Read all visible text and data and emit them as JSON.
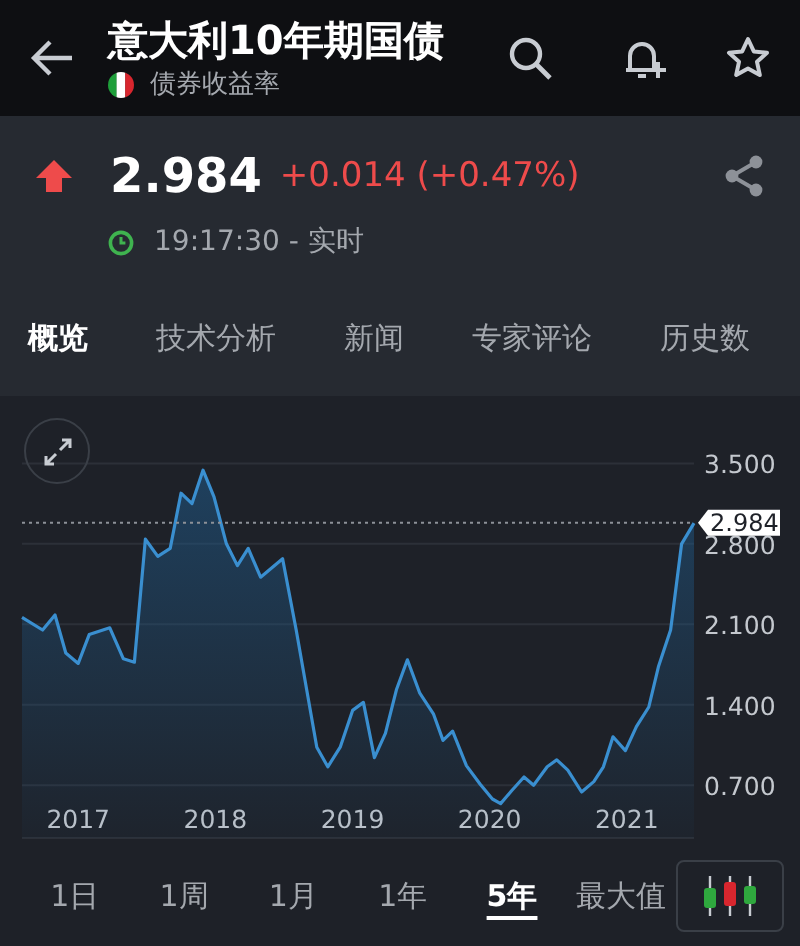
{
  "header": {
    "title": "意大利10年期国债",
    "subtitle": "债券收益率"
  },
  "quote": {
    "price": "2.984",
    "change": "+0.014 (+0.47%)",
    "up": true,
    "time": "19:17:30 - 实时"
  },
  "tabs": [
    {
      "label": "概览",
      "selected": true
    },
    {
      "label": "技术分析",
      "selected": false
    },
    {
      "label": "新闻",
      "selected": false
    },
    {
      "label": "专家评论",
      "selected": false
    },
    {
      "label": "历史数",
      "selected": false
    }
  ],
  "chart": {
    "chart_data": {
      "type": "area",
      "x": [
        2016.59,
        2016.74,
        2016.83,
        2016.91,
        2017.0,
        2017.08,
        2017.23,
        2017.33,
        2017.41,
        2017.49,
        2017.58,
        2017.67,
        2017.75,
        2017.83,
        2017.91,
        2017.99,
        2018.08,
        2018.16,
        2018.24,
        2018.33,
        2018.49,
        2018.59,
        2018.74,
        2018.82,
        2018.91,
        2019.0,
        2019.08,
        2019.16,
        2019.24,
        2019.32,
        2019.4,
        2019.49,
        2019.59,
        2019.66,
        2019.73,
        2019.83,
        2019.93,
        2020.02,
        2020.08,
        2020.16,
        2020.25,
        2020.32,
        2020.42,
        2020.49,
        2020.57,
        2020.67,
        2020.76,
        2020.83,
        2020.9,
        2020.99,
        2021.07,
        2021.16,
        2021.23,
        2021.32,
        2021.4,
        2021.49
      ],
      "series": [
        {
          "color": "#3a8fd0",
          "values": [
            2.16,
            2.05,
            2.18,
            1.85,
            1.76,
            2.01,
            2.07,
            1.8,
            1.77,
            2.84,
            2.69,
            2.76,
            3.24,
            3.15,
            3.44,
            3.21,
            2.8,
            2.61,
            2.76,
            2.51,
            2.67,
            2.05,
            1.03,
            0.86,
            1.03,
            1.35,
            1.42,
            0.94,
            1.15,
            1.53,
            1.79,
            1.5,
            1.32,
            1.09,
            1.17,
            0.87,
            0.71,
            0.58,
            0.54,
            0.65,
            0.77,
            0.7,
            0.86,
            0.92,
            0.83,
            0.64,
            0.73,
            0.86,
            1.12,
            1.0,
            1.21,
            1.38,
            1.73,
            2.05,
            2.8,
            2.98
          ]
        }
      ],
      "xlim": [
        2016.59,
        2021.49
      ],
      "ylim": [
        0.24,
        3.5
      ],
      "grid": true,
      "xticks": [
        {
          "value": 2017,
          "label": "2017"
        },
        {
          "value": 2018,
          "label": "2018"
        },
        {
          "value": 2019,
          "label": "2019"
        },
        {
          "value": 2020,
          "label": "2020"
        },
        {
          "value": 2021,
          "label": "2021"
        }
      ],
      "yticks": [
        {
          "value": 0.7,
          "label": "0.700"
        },
        {
          "value": 1.4,
          "label": "1.400"
        },
        {
          "value": 2.1,
          "label": "2.100"
        },
        {
          "value": 2.8,
          "label": "2.800"
        },
        {
          "value": 3.5,
          "label": "3.500"
        }
      ],
      "ref_lines": [
        {
          "axis": "y",
          "value": 2.984,
          "label": "2.984"
        }
      ]
    }
  },
  "ranges": [
    {
      "label": "1日",
      "selected": false
    },
    {
      "label": "1周",
      "selected": false
    },
    {
      "label": "1月",
      "selected": false
    },
    {
      "label": "1年",
      "selected": false
    },
    {
      "label": "5年",
      "selected": true
    },
    {
      "label": "最大值",
      "selected": false
    }
  ]
}
